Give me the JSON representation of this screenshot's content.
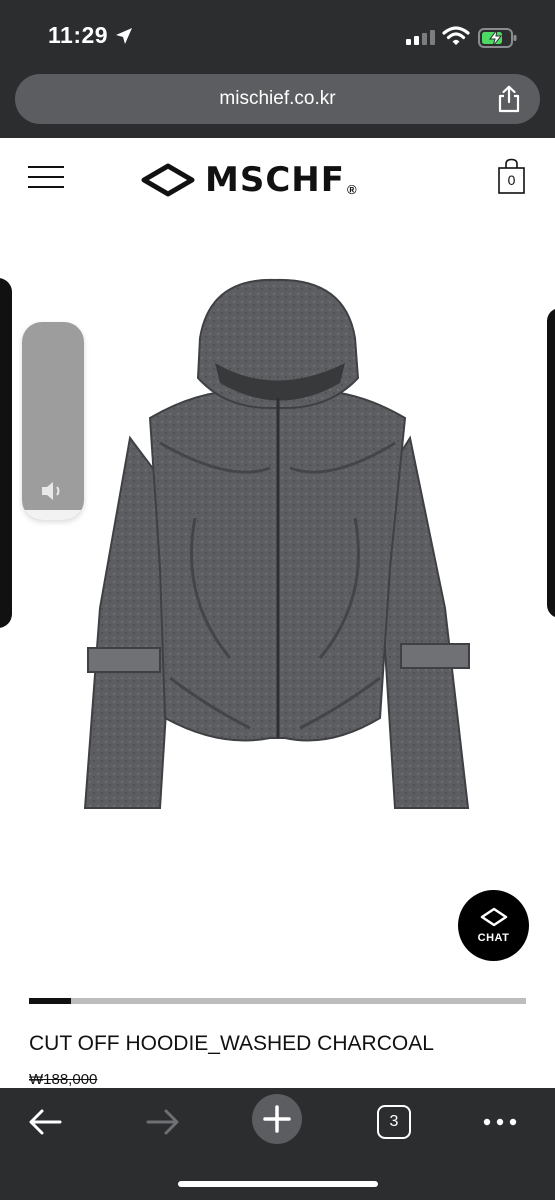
{
  "status_bar": {
    "time": "11:29"
  },
  "browser": {
    "url": "mischief.co.kr",
    "tab_count": "3"
  },
  "site": {
    "brand": "MSCHF",
    "registered_mark": "®",
    "cart_count": "0"
  },
  "product": {
    "name": "CUT OFF HOODIE_WASHED CHARCOAL",
    "price": "₩188,000",
    "image_description_icon": "product-image-icon",
    "image_progress": 0.085
  },
  "chat": {
    "label": "CHAT"
  },
  "colors": {
    "chrome": "#2b2d2f",
    "url_bar": "#5b5d60",
    "battery_green": "#4cd964",
    "garment": "#5a5b5e"
  }
}
